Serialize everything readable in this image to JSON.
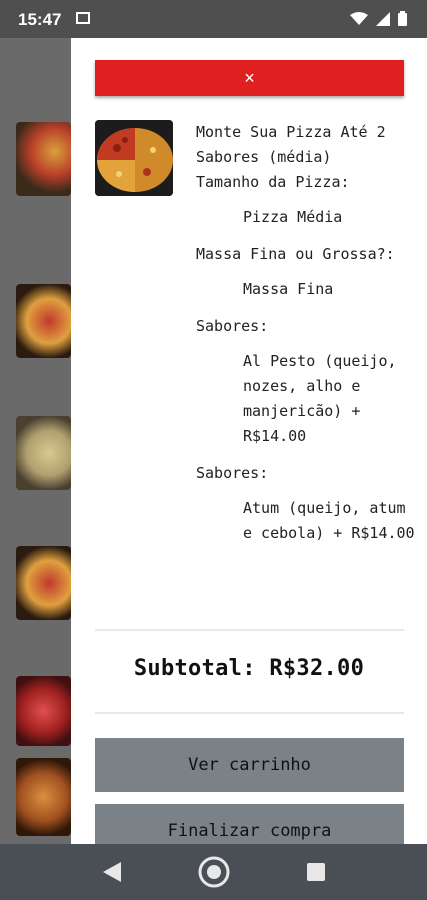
{
  "status_bar": {
    "time": "15:47"
  },
  "drawer": {
    "close_symbol": "×",
    "item": {
      "name": "Monte Sua Pizza Até 2 Sabores (média)",
      "options": [
        {
          "title": "Tamanho da Pizza:",
          "value": "Pizza Média"
        },
        {
          "title": "Massa Fina ou Grossa?:",
          "value": "Massa Fina"
        },
        {
          "title": "Sabores:",
          "value": "Al Pesto (queijo, nozes, alho e manjericão) + R$14.00"
        },
        {
          "title": "Sabores:",
          "value": "Atum (queijo, atum e cebola) + R$14.00"
        }
      ]
    },
    "subtotal_label": "Subtotal:",
    "subtotal_value": "R$32.00",
    "view_cart_label": "Ver carrinho",
    "checkout_label": "Finalizar compra"
  },
  "colors": {
    "accent_red": "#e02020",
    "button_gray": "#7a8187"
  },
  "nav": {
    "back_icon": "back-icon",
    "home_icon": "home-icon",
    "recents_icon": "recents-icon"
  }
}
